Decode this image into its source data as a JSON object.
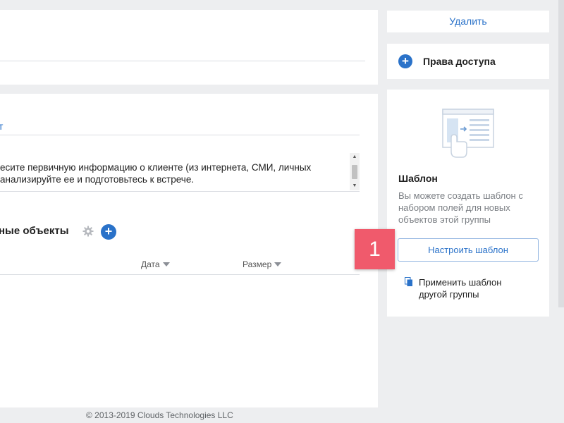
{
  "field": {
    "link_fragment": "т"
  },
  "textarea": {
    "line1": "есите первичную информацию о клиенте (из интернета, СМИ, личных",
    "line2": "анализируйте ее и подготовьтесь к встрече."
  },
  "objects": {
    "title": "ные объекты",
    "columns": {
      "date": "Дата",
      "size": "Размер"
    }
  },
  "sidebar": {
    "delete_label": "Удалить",
    "access_label": "Права доступа",
    "template": {
      "title": "Шаблон",
      "description": "Вы можете создать шаблон с набором полей для новых объектов этой группы",
      "configure_button": "Настроить шаблон",
      "apply_line1": "Применить шаблон",
      "apply_line2": "другой группы"
    }
  },
  "annotation": {
    "badge": "1"
  },
  "footer": {
    "copyright": "© 2013-2019 Clouds Technologies LLC"
  },
  "colors": {
    "accent": "#2a72c9",
    "badge": "#f05a6c",
    "background": "#edeef0"
  }
}
